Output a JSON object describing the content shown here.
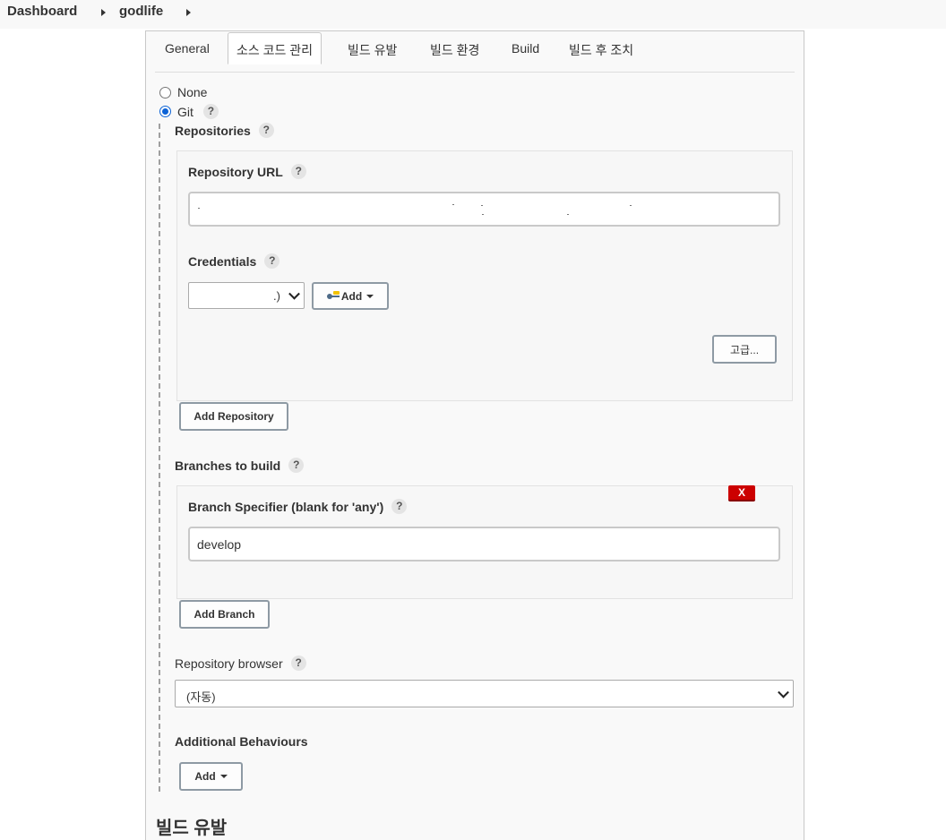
{
  "breadcrumb": {
    "items": [
      "Dashboard",
      "godlife"
    ]
  },
  "tabs": [
    {
      "label": "General"
    },
    {
      "label": "소스 코드 관리",
      "active": true
    },
    {
      "label": "빌드 유발"
    },
    {
      "label": "빌드 환경"
    },
    {
      "label": "Build"
    },
    {
      "label": "빌드 후 조치"
    }
  ],
  "scm": {
    "none_label": "None",
    "git_label": "Git",
    "selected": "Git",
    "repositories_label": "Repositories",
    "repository_url_label": "Repository URL",
    "repository_url_value": "",
    "credentials_label": "Credentials",
    "credentials_value": ".)",
    "add_credentials_label": "Add",
    "advanced_label": "고급...",
    "add_repository_label": "Add Repository",
    "branches_label": "Branches to build",
    "delete_branch_label": "X",
    "branch_specifier_label": "Branch Specifier (blank for 'any')",
    "branch_specifier_value": "develop",
    "add_branch_label": "Add Branch",
    "repository_browser_label": "Repository browser",
    "repository_browser_value": "(자동)",
    "additional_behaviours_label": "Additional Behaviours",
    "add_behaviour_label": "Add"
  },
  "next_section_heading": "빌드 유발",
  "help_glyph": "?",
  "colors": {
    "radio_checked": "#0b62d6",
    "delete_button": "#cc0000",
    "panel_background": "#f9f9f9"
  }
}
